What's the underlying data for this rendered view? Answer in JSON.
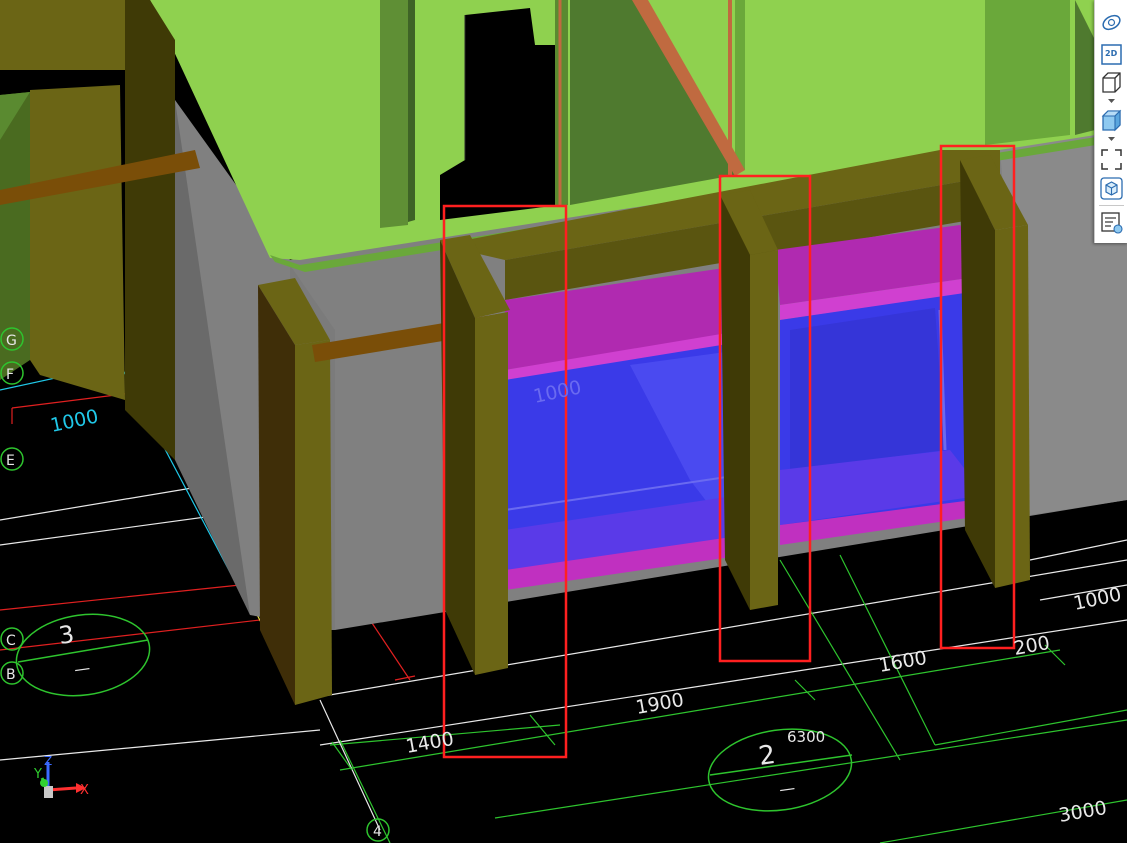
{
  "viewport": {
    "grid_labels": {
      "G": "G",
      "F": "F",
      "E": "E",
      "C": "C",
      "B": "B",
      "axis4": "4"
    },
    "dimensions": {
      "d_1000_left": "1000",
      "d_1000_window": "1000",
      "d_1400": "1400",
      "d_1900": "1900",
      "d_1600": "1600",
      "d_200": "200",
      "d_1000_right": "1000",
      "d_3000": "3000",
      "d_6300": "6300"
    },
    "section_markers": {
      "marker_3": "3",
      "marker_2": "2",
      "dash": "—"
    },
    "axis_triad": {
      "x": "X",
      "y": "Y",
      "z": "Z"
    }
  },
  "toolbar": {
    "buttons": [
      "orbit",
      "2d-view",
      "3d-box-view",
      "3d-solid-view",
      "zoom-extents",
      "view-cube",
      "layer-properties"
    ],
    "label_2d": "2D"
  },
  "colors": {
    "background": "#000000",
    "slab": "#8fd14f",
    "wall_dark": "#4f7a2f",
    "column": "#6b6515",
    "column_dark": "#3f3a06",
    "beam": "#7a4e08",
    "window_glass": "#3a3ae8",
    "window_frame": "#c030c0",
    "highlight_box": "#ff2020",
    "grid_green": "#2ec42e",
    "grid_red": "#e02020",
    "cyan_line": "#20c8e8"
  }
}
